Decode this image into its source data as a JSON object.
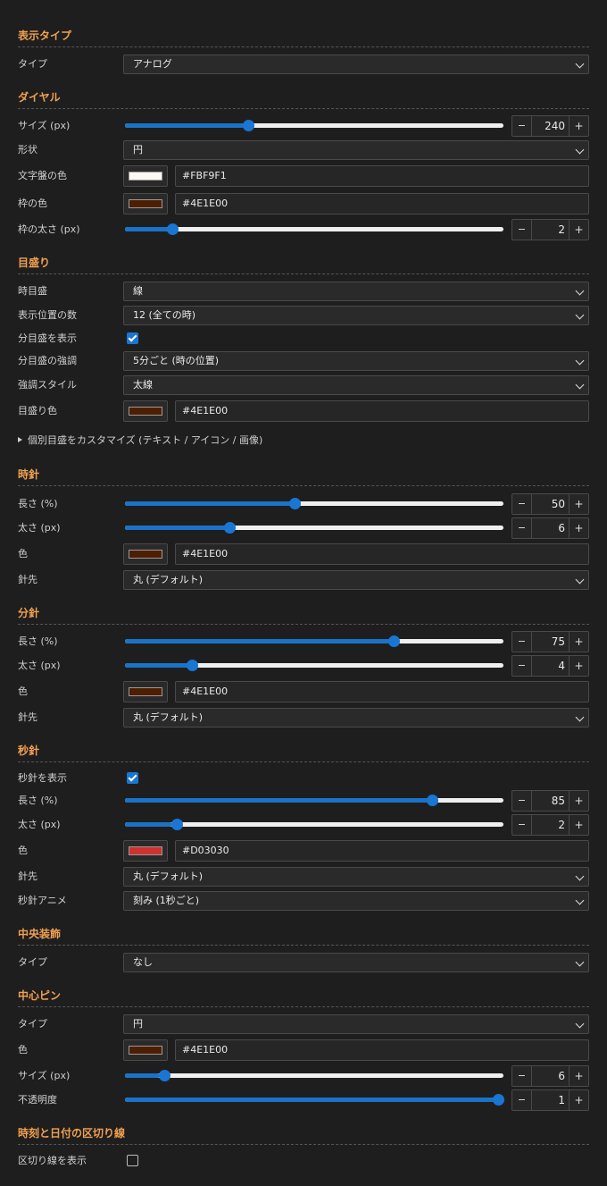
{
  "sections": {
    "display": {
      "title": "表示タイプ",
      "type_label": "タイプ",
      "type_value": "アナログ"
    },
    "dial": {
      "title": "ダイヤル",
      "size_label": "サイズ (px)",
      "size_value": "240",
      "size_fraction": 0.32,
      "shape_label": "形状",
      "shape_value": "円",
      "face_color_label": "文字盤の色",
      "face_color": "#FBF9F1",
      "border_color_label": "枠の色",
      "border_color": "#4E1E00",
      "border_width_label": "枠の太さ (px)",
      "border_width_value": "2",
      "border_width_fraction": 0.115
    },
    "ticks": {
      "title": "目盛り",
      "hour_tick_label": "時目盛",
      "hour_tick_value": "線",
      "positions_label": "表示位置の数",
      "positions_value": "12 (全ての時)",
      "minute_show_label": "分目盛を表示",
      "minute_show": true,
      "emphasis_label": "分目盛の強調",
      "emphasis_value": "5分ごと (時の位置)",
      "emphasis_style_label": "強調スタイル",
      "emphasis_style_value": "太線",
      "tick_color_label": "目盛り色",
      "tick_color": "#4E1E00",
      "customize_label": "個別目盛をカスタマイズ (テキスト / アイコン / 画像)"
    },
    "hour_hand": {
      "title": "時針",
      "length_label": "長さ (%)",
      "length_value": "50",
      "length_fraction": 0.447,
      "width_label": "太さ (px)",
      "width_value": "6",
      "width_fraction": 0.27,
      "color_label": "色",
      "color": "#4E1E00",
      "tip_label": "針先",
      "tip_value": "丸 (デフォルト)"
    },
    "minute_hand": {
      "title": "分針",
      "length_label": "長さ (%)",
      "length_value": "75",
      "length_fraction": 0.715,
      "width_label": "太さ (px)",
      "width_value": "4",
      "width_fraction": 0.168,
      "color_label": "色",
      "color": "#4E1E00",
      "tip_label": "針先",
      "tip_value": "丸 (デフォルト)"
    },
    "second_hand": {
      "title": "秒針",
      "show_label": "秒針を表示",
      "show": true,
      "length_label": "長さ (%)",
      "length_value": "85",
      "length_fraction": 0.82,
      "width_label": "太さ (px)",
      "width_value": "2",
      "width_fraction": 0.125,
      "color_label": "色",
      "color": "#D03030",
      "tip_label": "針先",
      "tip_value": "丸 (デフォルト)",
      "anim_label": "秒針アニメ",
      "anim_value": "刻み (1秒ごと)"
    },
    "center_deco": {
      "title": "中央装飾",
      "type_label": "タイプ",
      "type_value": "なし"
    },
    "center_pin": {
      "title": "中心ピン",
      "type_label": "タイプ",
      "type_value": "円",
      "color_label": "色",
      "color": "#4E1E00",
      "size_label": "サイズ (px)",
      "size_value": "6",
      "size_fraction": 0.092,
      "opacity_label": "不透明度",
      "opacity_value": "1",
      "opacity_fraction": 1.0
    },
    "divider": {
      "title": "時刻と日付の区切り線",
      "show_label": "区切り線を表示",
      "show": false
    }
  },
  "stepper": {
    "minus": "−",
    "plus": "+"
  }
}
